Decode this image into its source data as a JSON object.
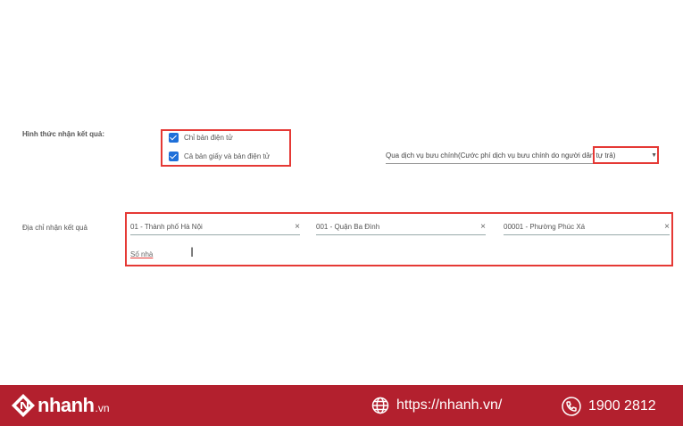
{
  "form": {
    "receive_method_label": "Hình thức nhận kết quả:",
    "options": [
      {
        "label": "Chỉ bản điện tử",
        "checked": true
      },
      {
        "label": "Cả bản giấy và bản điện tử",
        "checked": true
      }
    ],
    "postal_service": "Qua dịch vụ bưu chính(Cước phí dịch vụ bưu chính do người dân tự trả)",
    "address_label": "Địa chỉ nhận kết quả",
    "province": "01 - Thành phố Hà Nội",
    "district": "001 - Quận Ba Đình",
    "ward": "00001 - Phường Phúc Xá",
    "street_placeholder": "Số nhà",
    "clear_symbol": "×"
  },
  "footer": {
    "brand": "nhanh",
    "brand_suffix": ".vn",
    "website": "https://nhanh.vn/",
    "phone": "1900 2812",
    "background_color": "#b3202e"
  },
  "colors": {
    "highlight_border": "#e53935",
    "checkbox": "#1e6fd9"
  }
}
